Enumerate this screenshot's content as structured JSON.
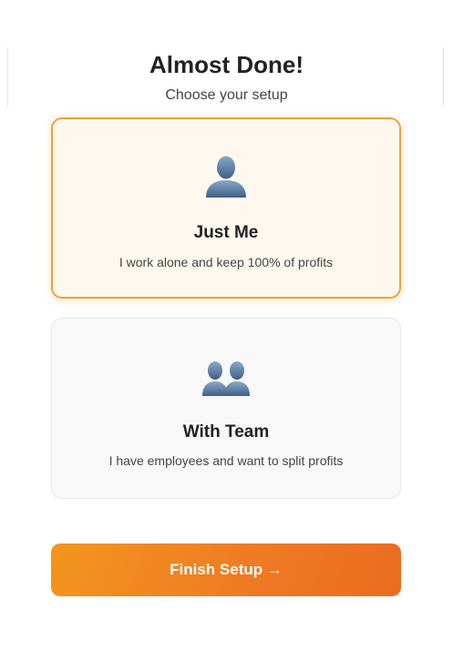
{
  "header": {
    "title": "Almost Done!",
    "subtitle": "Choose your setup"
  },
  "options": [
    {
      "icon": "person-silhouette-icon",
      "title": "Just Me",
      "description": "I work alone and keep 100% of profits",
      "selected": true
    },
    {
      "icon": "two-people-silhouette-icon",
      "title": "With Team",
      "description": "I have employees and want to split profits",
      "selected": false
    }
  ],
  "footer": {
    "finish_label": "Finish Setup →"
  },
  "colors": {
    "accent": "#f0a23a",
    "selected_bg": "#fff8ee",
    "button_start": "#f3951f",
    "button_end": "#ea6c20",
    "icon_blue": "#5a7fa8"
  }
}
